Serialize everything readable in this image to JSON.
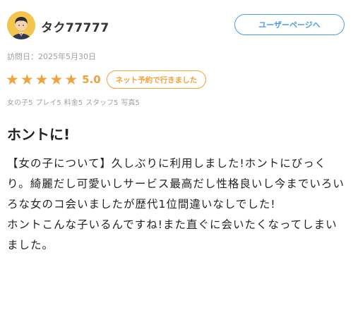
{
  "user": {
    "name": "タク77777",
    "user_page_button": "ユーザーページへ"
  },
  "visit": {
    "label": "訪問日：2025年5月30日"
  },
  "rating": {
    "stars": 5,
    "max": 5,
    "value": "5.0",
    "badge": "ネット予約で行きました"
  },
  "sub_ratings": [
    "女の子5",
    "プレイ5",
    "料金5",
    "スタッフ5",
    "写真5"
  ],
  "review": {
    "title": "ホントに!",
    "paragraphs": [
      "【女の子について】久しぶりに利用しました!ホントにびっくり。綺麗だし可愛いしサービス最高だし性格良いし今までいろいろな女のコ会いましたが歴代1位間違いなしでした!",
      "ホントこんな子いるんですね!また直ぐに会いたくなってしまいました。"
    ]
  },
  "colors": {
    "accent_orange": "#f0a23b",
    "accent_blue": "#4d9ee8",
    "avatar_bg": "#f4c54d",
    "muted_text": "#a0a0a0"
  },
  "icons": {
    "avatar": "user-avatar-icon",
    "star": "star-icon"
  }
}
